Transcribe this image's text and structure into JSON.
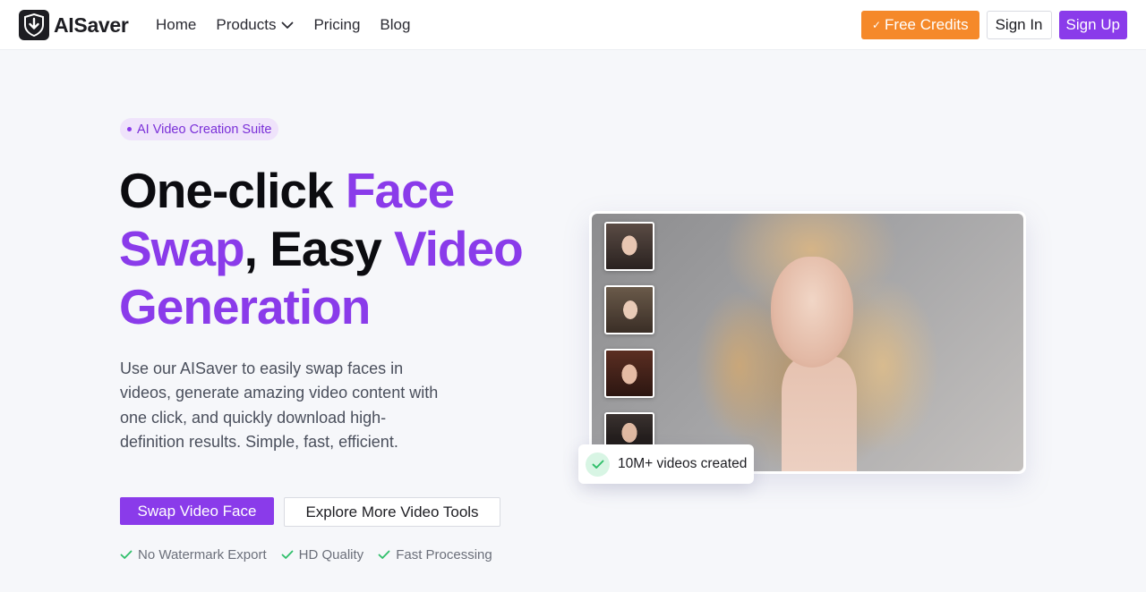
{
  "header": {
    "logo_text": "AISaver",
    "logo_icon": "download-shield-icon",
    "nav": [
      {
        "label": "Home"
      },
      {
        "label": "Products",
        "icon": "chevron-down-icon"
      },
      {
        "label": "Pricing"
      },
      {
        "label": "Blog"
      }
    ],
    "free_credits_label": "Free Credits",
    "sign_in_label": "Sign In",
    "sign_up_label": "Sign Up"
  },
  "hero": {
    "badge": "AI Video Creation Suite",
    "headline": {
      "part1": "One-click ",
      "part2": "Face",
      "part3": "Swap",
      "part4": ", Easy ",
      "part5": "Video",
      "part6": "Generation"
    },
    "description": "Use our AISaver to easily swap faces in videos, generate amazing video content with one click, and quickly download high-definition results. Simple, fast, efficient.",
    "primary_cta": "Swap Video Face",
    "secondary_cta": "Explore More Video Tools",
    "features": [
      "No Watermark Export",
      "HD Quality",
      "Fast Processing"
    ]
  },
  "preview": {
    "stat": "10M+ videos created"
  },
  "colors": {
    "accent": "#8a3bea",
    "orange": "#f5892a",
    "success": "#2fbf6a"
  }
}
